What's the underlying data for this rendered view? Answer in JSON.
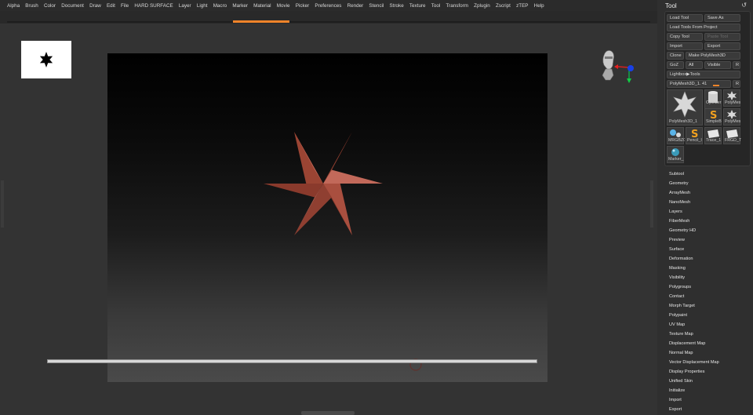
{
  "menubar": {
    "items": [
      "Alpha",
      "Brush",
      "Color",
      "Document",
      "Draw",
      "Edit",
      "File",
      "HARD SURFACE",
      "Layer",
      "Light",
      "Macro",
      "Marker",
      "Material",
      "Movie",
      "Picker",
      "Preferences",
      "Render",
      "Stencil",
      "Stroke",
      "Texture",
      "Tool",
      "Transform",
      "Zplugin",
      "Zscript",
      "zTEP",
      "Help"
    ]
  },
  "colors": {
    "accent": "#f0842a",
    "star": "#9a4433",
    "background": "#303030"
  },
  "tool_palette": {
    "title": "Tool",
    "load_tool": "Load Tool",
    "save_as": "Save As",
    "load_from_project": "Load Tools From Project",
    "copy_tool": "Copy Tool",
    "paste_tool": "Paste Tool",
    "import": "Import",
    "export": "Export",
    "clone": "Clone",
    "make_polymesh": "Make PolyMesh3D",
    "goz": "GoZ",
    "all": "All",
    "visible": "Visible",
    "r": "R",
    "lightbox_tools": "Lightbox▶Tools",
    "current_tool": "PolyMesh3D_1. 41",
    "tools": [
      {
        "label": "PolyMesh3D_1",
        "icon": "star-icon"
      },
      {
        "label": "Cylinder",
        "icon": "cylinder-icon"
      },
      {
        "label": "PolyMes",
        "icon": "star-icon"
      },
      {
        "label": "SimpleB",
        "icon": "simplebrush-icon"
      },
      {
        "label": "PolyMes",
        "icon": "star-icon"
      },
      {
        "label": "MRGBZG",
        "icon": "mrgbz-icon"
      },
      {
        "label": "Pencil_I",
        "icon": "pencil-icon"
      },
      {
        "label": "Trace_1",
        "icon": "tile-icon"
      },
      {
        "label": "FRGD_T",
        "icon": "tile-icon"
      },
      {
        "label": "Marker_",
        "icon": "sphere-icon"
      }
    ],
    "subpalettes": [
      "Subtool",
      "Geometry",
      "ArrayMesh",
      "NanoMesh",
      "Layers",
      "FiberMesh",
      "Geometry HD",
      "Preview",
      "Surface",
      "Deformation",
      "Masking",
      "Visibility",
      "Polygroups",
      "Contact",
      "Morph Target",
      "Polypaint",
      "UV Map",
      "Texture Map",
      "Displacement Map",
      "Normal Map",
      "Vector Displacement Map",
      "Display Properties",
      "Unified Skin",
      "Initialize",
      "Import",
      "Export"
    ]
  }
}
